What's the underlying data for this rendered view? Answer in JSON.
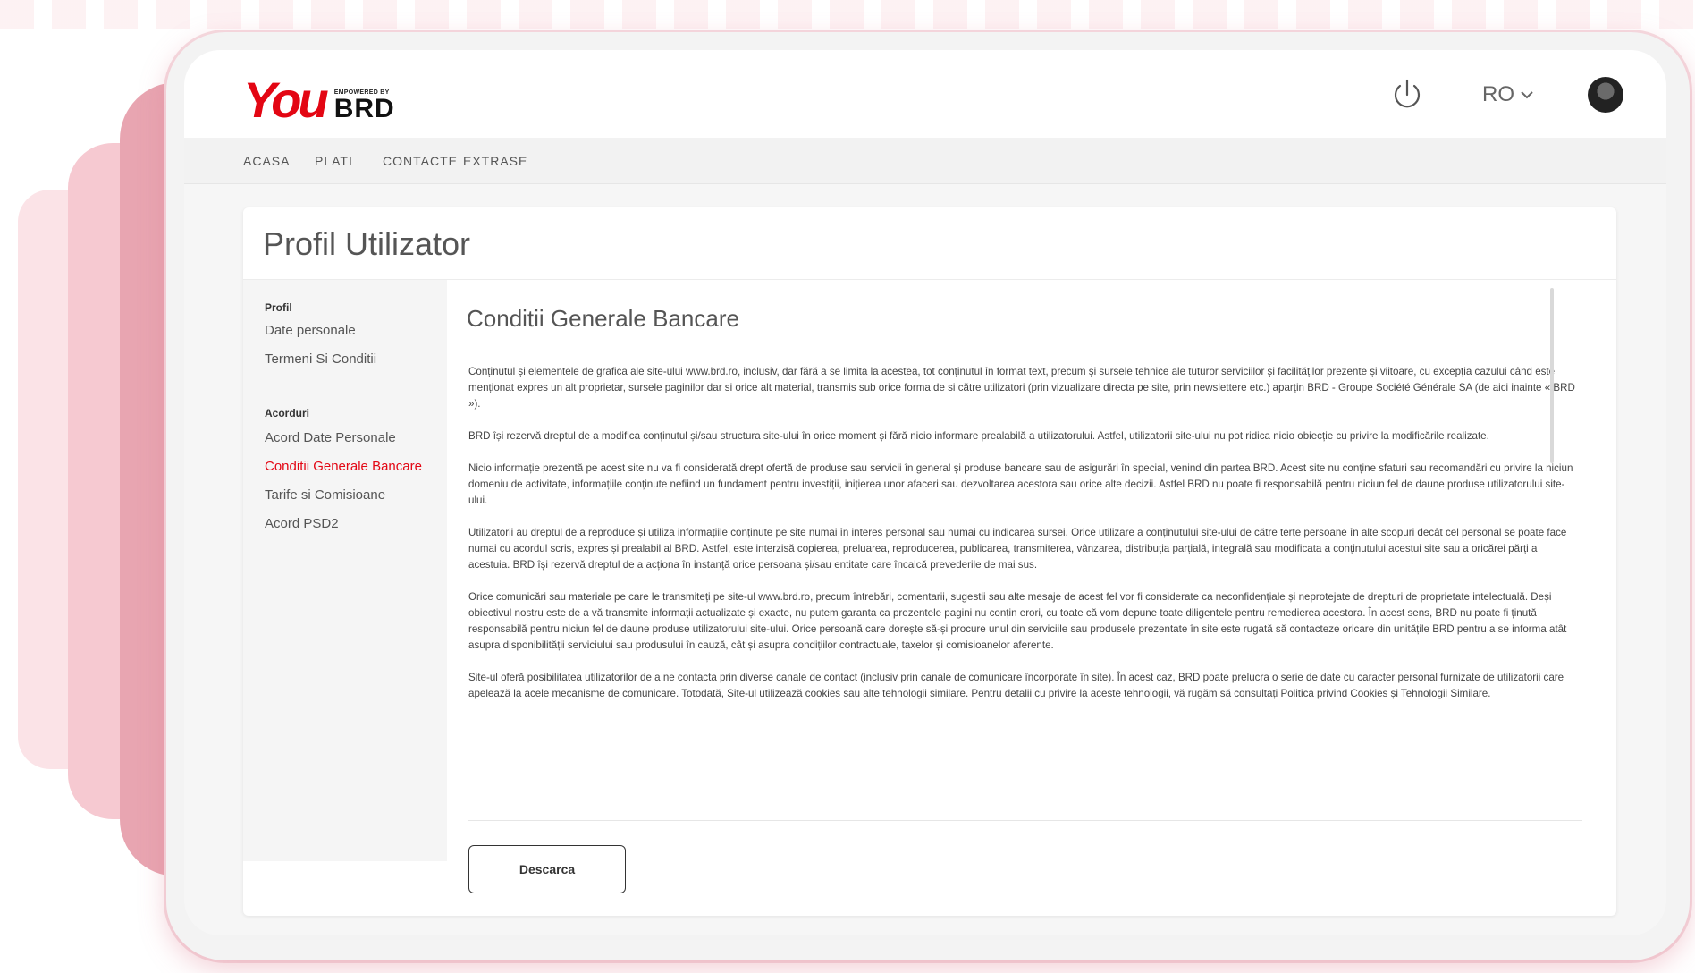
{
  "brand": {
    "logo_main": "You",
    "logo_tagline": "EMPOWERED BY",
    "logo_brand": "BRD",
    "accent_color": "#e30613"
  },
  "header": {
    "power_icon": "power-icon",
    "language": "RO",
    "language_icon": "chevron-down-icon"
  },
  "nav": {
    "items": [
      "ACASA",
      "PLATI",
      "CONTACTE",
      "EXTRASE"
    ]
  },
  "page": {
    "title": "Profil Utilizator"
  },
  "sidebar": {
    "section_profil": "Profil",
    "profil_items": [
      "Date personale",
      "Termeni Si Conditii"
    ],
    "section_acorduri": "Acorduri",
    "acorduri_items": [
      "Acord Date Personale",
      "Conditii Generale Bancare",
      "Tarife si Comisioane",
      "Acord PSD2"
    ],
    "active_item": "Conditii Generale Bancare"
  },
  "content": {
    "title": "Conditii Generale Bancare",
    "paragraphs": [
      "Conținutul și elementele de grafica ale site-ului www.brd.ro, inclusiv, dar fără a se limita la acestea, tot conținutul în format text, precum și sursele tehnice ale tuturor serviciilor și facilităților prezente și viitoare, cu excepția cazului când este menționat expres un alt proprietar, sursele paginilor dar si orice alt material, transmis sub orice forma de si către utilizatori (prin vizualizare directa pe site, prin newslettere etc.) aparțin BRD - Groupe Société Générale SA (de aici inainte « BRD »).",
      "BRD își rezervă dreptul de a modifica conținutul și/sau structura site-ului în orice moment și fără nicio informare prealabilă a utilizatorului. Astfel, utilizatorii site-ului nu pot ridica nicio obiecție cu privire la modificările realizate.",
      "Nicio informație prezentă pe acest site nu va fi considerată drept ofertă de produse sau servicii în general și produse bancare sau de asigurări în special, venind din partea BRD. Acest site nu conține sfaturi sau recomandări cu privire la niciun domeniu de activitate, informațiile conținute nefiind un fundament pentru investiții, inițierea unor afaceri sau dezvoltarea acestora sau orice alte decizii. Astfel BRD nu poate fi responsabilă pentru niciun fel de daune produse utilizatorului site-ului.",
      "Utilizatorii au dreptul de a reproduce și utiliza informațiile conținute pe site numai în interes personal sau numai cu indicarea sursei. Orice utilizare a conținutului site-ului de către terțe persoane în alte scopuri decât cel personal se poate face numai cu acordul scris, expres și prealabil al BRD. Astfel, este interzisă copierea, preluarea, reproducerea, publicarea, transmiterea, vânzarea, distribuția parțială, integrală sau modificata a conținutului acestui site sau a oricărei părți a acestuia. BRD își rezervă dreptul de a acționa în instanță orice persoana și/sau entitate care încalcă prevederile de mai sus.",
      "Orice comunicări sau materiale pe care le transmiteți pe site-ul www.brd.ro, precum întrebări, comentarii, sugestii sau alte mesaje de acest fel vor fi considerate ca neconfidențiale și neprotejate de drepturi de proprietate intelectuală. Deși obiectivul nostru este de a vă transmite informații actualizate și exacte, nu putem garanta ca prezentele pagini nu conțin erori, cu toate că vom depune toate diligentele pentru remedierea acestora. În acest sens, BRD nu poate fi ținută responsabilă pentru niciun fel de daune produse utilizatorului site-ului. Orice persoană care dorește să-și procure unul din serviciile sau produsele prezentate în site este rugată să contacteze oricare din unitățile BRD pentru a se informa atât asupra disponibilității serviciului sau produsului în cauză, cât și asupra condițiilor contractuale, taxelor și comisioanelor aferente.",
      "Site-ul oferă posibilitatea utilizatorilor de a ne contacta prin diverse canale de contact (inclusiv prin canale de comunicare încorporate în site). În acest caz, BRD poate prelucra o serie de date cu caracter personal furnizate de utilizatorii care apelează la acele mecanisme de comunicare. Totodată, Site-ul utilizează cookies sau alte tehnologii similare. Pentru detalii cu privire la aceste tehnologii, vă rugăm să consultați Politica privind Cookies și Tehnologii Similare."
    ],
    "download_label": "Descarca"
  }
}
